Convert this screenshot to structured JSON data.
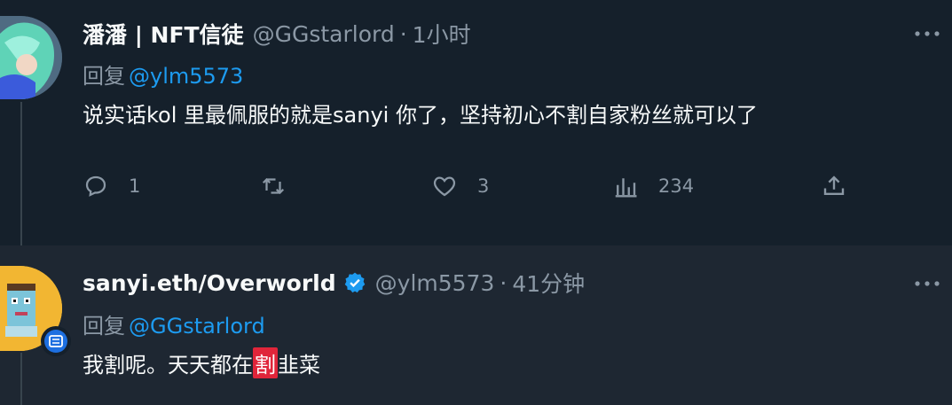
{
  "tweet1": {
    "name": "潘潘 | NFT信徒",
    "handle": "@GGstarlord",
    "separator": "·",
    "time": "1小时",
    "reply_prefix": "回复",
    "reply_to": "@ylm5573",
    "text": "说实话kol 里最佩服的就是sanyi 你了，坚持初心不割自家粉丝就可以了",
    "actions": {
      "reply_count": "1",
      "retweet_count": "",
      "like_count": "3",
      "views_count": "234"
    }
  },
  "tweet2": {
    "name": "sanyi.eth/Overworld",
    "handle": "@ylm5573",
    "separator": "·",
    "time": "41分钟",
    "reply_prefix": "回复",
    "reply_to": "@GGstarlord",
    "text_before": "我割呢。天天都在",
    "text_highlight": "割",
    "text_after": "韭菜"
  },
  "colors": {
    "background": "#15202b",
    "highlight_background": "#1e2732",
    "accent": "#1d9bf0",
    "muted": "#8b98a5",
    "highlight_red": "#e0253a"
  }
}
